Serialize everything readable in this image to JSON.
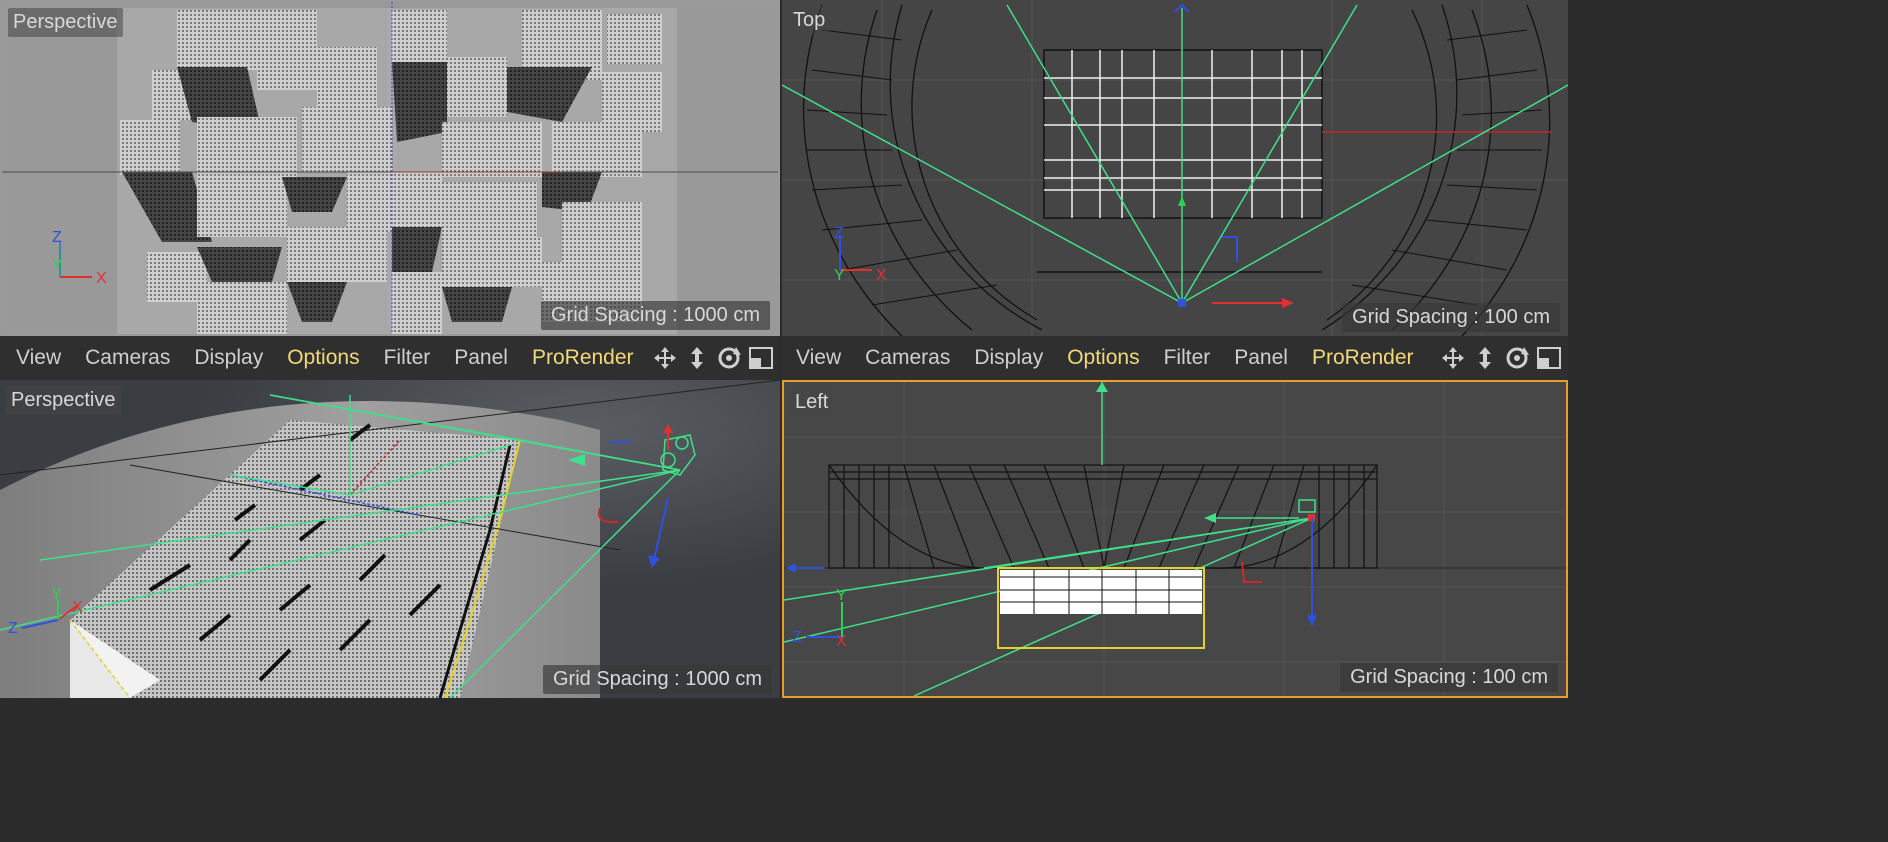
{
  "viewports": {
    "top_left": {
      "label": "Perspective",
      "grid": "Grid Spacing : 1000 cm"
    },
    "top_right": {
      "label": "Top",
      "grid": "Grid Spacing : 100 cm"
    },
    "bottom_left": {
      "label": "Perspective",
      "grid": "Grid Spacing : 1000 cm"
    },
    "bottom_right": {
      "label": "Left",
      "grid": "Grid Spacing : 100 cm"
    }
  },
  "axes": {
    "x": "X",
    "y": "Y",
    "z": "Z"
  },
  "menu": [
    "View",
    "Cameras",
    "Display",
    "Options",
    "Filter",
    "Panel",
    "ProRender"
  ],
  "highlighted_menu": [
    "Options",
    "ProRender"
  ],
  "toolbar_icons": [
    "move-view-icon",
    "zoom-view-icon",
    "rotate-view-icon",
    "toggle-layout-icon"
  ],
  "colors": {
    "accent": "#f1d97a",
    "active_border": "#e0a12a",
    "camera_lines": "#3fe08a",
    "axis_x": "#e03030",
    "axis_y": "#2fd050",
    "axis_z": "#3050e0"
  }
}
